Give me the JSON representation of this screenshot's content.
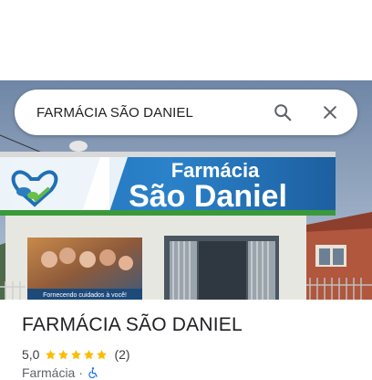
{
  "search": {
    "query": "FARMÁCIA SÃO DANIEL",
    "search_icon": "search-icon",
    "clear_icon": "close-icon"
  },
  "photo": {
    "sign_line1": "Farmácia",
    "sign_line2": "São Daniel",
    "banner_text": "Fornecendo cuidados à você!"
  },
  "place": {
    "name": "FARMÁCIA SÃO DANIEL",
    "rating": "5,0",
    "stars": 5,
    "review_count": "(2)",
    "category": "Farmácia",
    "separator": "·",
    "accessibility_icon": "wheelchair-icon",
    "colors": {
      "star": "#fbbc04",
      "text": "#202124",
      "accessibility": "#1a73e8"
    }
  }
}
